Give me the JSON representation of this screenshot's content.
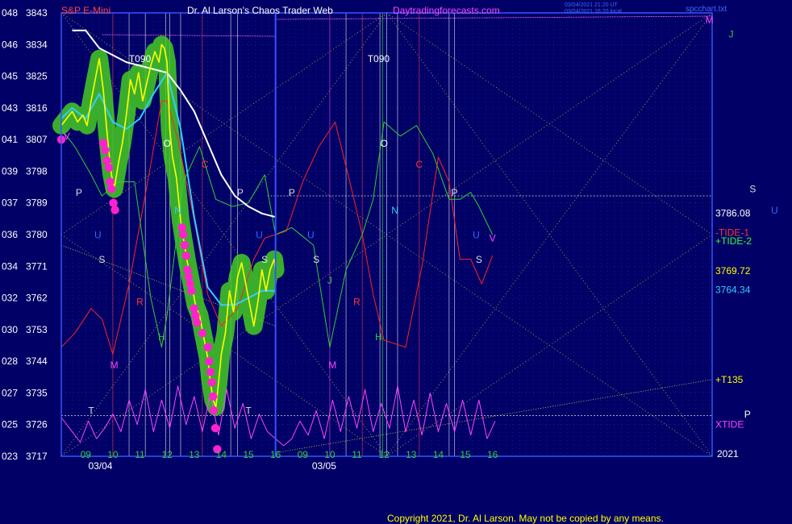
{
  "header": {
    "instrument": "S&P E-Mini",
    "title": "Dr. Al Larson's Chaos Trader Web",
    "site": "Daytradingforecasts.com",
    "stamp_line1": "03/04/2021 21:20 UT",
    "stamp_line2": "03/04/2021 16:20 local",
    "file_name": "spcchart.txt"
  },
  "footer": {
    "copyright": "Copyright 2021, Dr. Al Larson. May not be copied by any means."
  },
  "year_label": "2021",
  "colors": {
    "background": "#000066",
    "price": "#ffff00",
    "price_glow": "#44cc22",
    "ema_fast": "#33ccff",
    "ema_slow": "#ffffff",
    "tide1": "#ff2222",
    "tide2": "#33cc33",
    "xtide": "#ff44ff",
    "dots": "#ff22cc",
    "axis": "#3355ff",
    "text_light": "#ffffff"
  },
  "chart_data": {
    "type": "line",
    "title": "Dr. Al Larson's Chaos Trader Web",
    "xlabel": "",
    "ylabel": "",
    "ylim": [
      3717,
      3843
    ],
    "y_ticks": [
      {
        "left": "048",
        "value": 3843
      },
      {
        "left": "046",
        "value": 3834
      },
      {
        "left": "045",
        "value": 3825
      },
      {
        "left": "043",
        "value": 3816
      },
      {
        "left": "041",
        "value": 3807
      },
      {
        "left": "039",
        "value": 3798
      },
      {
        "left": "037",
        "value": 3789
      },
      {
        "left": "036",
        "value": 3780
      },
      {
        "left": "034",
        "value": 3771
      },
      {
        "left": "032",
        "value": 3762
      },
      {
        "left": "030",
        "value": 3753
      },
      {
        "left": "028",
        "value": 3744
      },
      {
        "left": "027",
        "value": 3735
      },
      {
        "left": "025",
        "value": 3726
      },
      {
        "left": "023",
        "value": 3717
      }
    ],
    "x_range": [
      8.1,
      32.1
    ],
    "hour_ticks": [
      {
        "label": "09",
        "x": 9
      },
      {
        "label": "10",
        "x": 10
      },
      {
        "label": "11",
        "x": 11
      },
      {
        "label": "12",
        "x": 12
      },
      {
        "label": "13",
        "x": 13
      },
      {
        "label": "14",
        "x": 14
      },
      {
        "label": "15",
        "x": 15
      },
      {
        "label": "16",
        "x": 16
      },
      {
        "label": "09",
        "x": 17
      },
      {
        "label": "10",
        "x": 18
      },
      {
        "label": "11",
        "x": 19
      },
      {
        "label": "12",
        "x": 20
      },
      {
        "label": "13",
        "x": 21
      },
      {
        "label": "14",
        "x": 22
      },
      {
        "label": "15",
        "x": 23
      },
      {
        "label": "16",
        "x": 24
      }
    ],
    "dates": [
      {
        "label": "03/04",
        "x": 8.5
      },
      {
        "label": "03/05",
        "x": 16.75
      }
    ],
    "right_labels": [
      {
        "text": "3786.08",
        "value": 3786.08,
        "color": "#ffffff"
      },
      {
        "text": "-TIDE-1",
        "value": 3780.6,
        "color": "#ff3333"
      },
      {
        "text": "+TIDE-2",
        "value": 3778.2,
        "color": "#33ff33"
      },
      {
        "text": "3769.72",
        "value": 3769.72,
        "color": "#ffff00"
      },
      {
        "text": "3764.34",
        "value": 3764.34,
        "color": "#33ccff"
      },
      {
        "text": "+T135",
        "value": 3738.8,
        "color": "#ffff00"
      },
      {
        "text": "XTIDE",
        "value": 3726,
        "color": "#ff44ff"
      }
    ],
    "annotations": [
      {
        "text": "T090",
        "x": 11.0,
        "y": 3829,
        "color": "#ffffff"
      },
      {
        "text": "T090",
        "x": 19.8,
        "y": 3829,
        "color": "#ffffff"
      },
      {
        "text": "M",
        "x": 32.0,
        "y": 3840,
        "color": "#ff44ff"
      },
      {
        "text": "J",
        "x": 32.8,
        "y": 3836,
        "color": "#33cc33"
      },
      {
        "text": "S",
        "x": 33.6,
        "y": 3792,
        "color": "#dddddd"
      },
      {
        "text": "U",
        "x": 34.4,
        "y": 3786,
        "color": "#3366ff"
      },
      {
        "text": "P",
        "x": 33.4,
        "y": 3728,
        "color": "#ffffff"
      },
      {
        "text": "V",
        "x": 8.3,
        "y": 3807,
        "color": "#ff44ff"
      },
      {
        "text": "P",
        "x": 8.75,
        "y": 3791,
        "color": "#dddddd"
      },
      {
        "text": "U",
        "x": 9.45,
        "y": 3779,
        "color": "#3366ff"
      },
      {
        "text": "S",
        "x": 9.6,
        "y": 3772,
        "color": "#dddddd"
      },
      {
        "text": "R",
        "x": 11.0,
        "y": 3760,
        "color": "#ff3333"
      },
      {
        "text": "H",
        "x": 11.8,
        "y": 3750,
        "color": "#33cc33"
      },
      {
        "text": "M",
        "x": 10.05,
        "y": 3742,
        "color": "#ff44ff"
      },
      {
        "text": "T",
        "x": 9.2,
        "y": 3729,
        "color": "#dddddd"
      },
      {
        "text": "O",
        "x": 12.0,
        "y": 3805,
        "color": "#ffffff"
      },
      {
        "text": "N",
        "x": 12.4,
        "y": 3786,
        "color": "#33ccff"
      },
      {
        "text": "C",
        "x": 13.4,
        "y": 3799,
        "color": "#ff3333"
      },
      {
        "text": "P",
        "x": 14.7,
        "y": 3791,
        "color": "#dddddd"
      },
      {
        "text": "U",
        "x": 15.4,
        "y": 3779,
        "color": "#3366ff"
      },
      {
        "text": "S",
        "x": 15.6,
        "y": 3772,
        "color": "#dddddd"
      },
      {
        "text": "T",
        "x": 15.0,
        "y": 3729,
        "color": "#dddddd"
      },
      {
        "text": "P",
        "x": 16.6,
        "y": 3791,
        "color": "#dddddd"
      },
      {
        "text": "U",
        "x": 17.3,
        "y": 3779,
        "color": "#3366ff"
      },
      {
        "text": "S",
        "x": 17.5,
        "y": 3772,
        "color": "#dddddd"
      },
      {
        "text": "J",
        "x": 18.0,
        "y": 3766,
        "color": "#33cc33"
      },
      {
        "text": "R",
        "x": 19.0,
        "y": 3760,
        "color": "#ff3333"
      },
      {
        "text": "H",
        "x": 19.8,
        "y": 3750,
        "color": "#33cc33"
      },
      {
        "text": "M",
        "x": 18.1,
        "y": 3742,
        "color": "#ff44ff"
      },
      {
        "text": "O",
        "x": 20.0,
        "y": 3805,
        "color": "#ffffff"
      },
      {
        "text": "N",
        "x": 20.4,
        "y": 3786,
        "color": "#33ccff"
      },
      {
        "text": "C",
        "x": 21.3,
        "y": 3799,
        "color": "#ff3333"
      },
      {
        "text": "P",
        "x": 22.6,
        "y": 3791,
        "color": "#dddddd"
      },
      {
        "text": "U",
        "x": 23.4,
        "y": 3779,
        "color": "#3366ff"
      },
      {
        "text": "S",
        "x": 23.5,
        "y": 3772,
        "color": "#dddddd"
      },
      {
        "text": "V",
        "x": 24.0,
        "y": 3778,
        "color": "#ff44ff"
      }
    ],
    "vertical_lines": [
      {
        "x": 10.0,
        "color": "#ff4444"
      },
      {
        "x": 10.6,
        "color": "#ffffff"
      },
      {
        "x": 11.2,
        "color": "#ffffff"
      },
      {
        "x": 11.95,
        "color": "#ffffff"
      },
      {
        "x": 12.1,
        "color": "#ffffff"
      },
      {
        "x": 12.5,
        "color": "#ffffff"
      },
      {
        "x": 13.3,
        "color": "#ff4444"
      },
      {
        "x": 14.35,
        "color": "#ffffff"
      },
      {
        "x": 14.6,
        "color": "#ffffff"
      },
      {
        "x": 18.0,
        "color": "#ff44ff"
      },
      {
        "x": 18.6,
        "color": "#ffffff"
      },
      {
        "x": 19.2,
        "color": "#ff4444"
      },
      {
        "x": 19.85,
        "color": "#ffffff"
      },
      {
        "x": 19.95,
        "color": "#33ff33"
      },
      {
        "x": 20.1,
        "color": "#ffffff"
      },
      {
        "x": 20.5,
        "color": "#ffffff"
      },
      {
        "x": 21.3,
        "color": "#ff4444"
      },
      {
        "x": 22.4,
        "color": "#ffffff"
      },
      {
        "x": 22.6,
        "color": "#ffffff"
      }
    ],
    "horizontal_lines": [
      {
        "y": 3791.0,
        "x_from": 15.7,
        "x_to": 32.1,
        "color": "#dddddd"
      },
      {
        "y": 3728.6,
        "x_from": 8.1,
        "x_to": 32.1,
        "color": "#dddddd"
      }
    ],
    "series": [
      {
        "name": "Price",
        "color": "#ffff00",
        "x": [
          8.1,
          8.3,
          8.5,
          8.7,
          8.9,
          9.05,
          9.2,
          9.35,
          9.5,
          9.65,
          9.75,
          9.85,
          9.95,
          10.05,
          10.2,
          10.35,
          10.5,
          10.65,
          10.8,
          10.95,
          11.1,
          11.25,
          11.4,
          11.55,
          11.7,
          11.8,
          11.9,
          12.0,
          12.1,
          12.2,
          12.35,
          12.5,
          12.6,
          12.75,
          12.9,
          13.05,
          13.2,
          13.35,
          13.5,
          13.6,
          13.7,
          13.8,
          13.9,
          14.0,
          14.15,
          14.3,
          14.45,
          14.6,
          14.75,
          14.9,
          15.05,
          15.2,
          15.35,
          15.5,
          15.65,
          15.8,
          15.95,
          16.0
        ],
        "y": [
          3811,
          3813,
          3815,
          3812,
          3814,
          3811,
          3818,
          3824,
          3830,
          3821,
          3812,
          3804,
          3797,
          3793,
          3800,
          3806,
          3814,
          3824,
          3820,
          3826,
          3818,
          3823,
          3828,
          3832,
          3829,
          3834,
          3833,
          3829,
          3810,
          3802,
          3796,
          3784,
          3779,
          3772,
          3766,
          3760,
          3757,
          3751,
          3745,
          3738,
          3733,
          3731,
          3738,
          3746,
          3752,
          3764,
          3758,
          3768,
          3772,
          3766,
          3760,
          3754,
          3761,
          3770,
          3764,
          3770,
          3773,
          3770
        ]
      },
      {
        "name": "EMA fast",
        "color": "#33ccff",
        "x": [
          8.1,
          8.5,
          9.0,
          9.5,
          10.0,
          10.5,
          11.0,
          11.5,
          12.0,
          12.5,
          13.0,
          13.5,
          14.0,
          14.5,
          15.0,
          15.5,
          16.0
        ],
        "y": [
          3813,
          3816,
          3813,
          3820,
          3812,
          3810,
          3813,
          3820,
          3826,
          3810,
          3785,
          3765,
          3760,
          3760,
          3762,
          3764,
          3764
        ]
      },
      {
        "name": "EMA slow",
        "color": "#ffffff",
        "x": [
          8.5,
          9.0,
          9.5,
          10.0,
          10.5,
          11.0,
          11.5,
          12.0,
          12.5,
          13.0,
          13.5,
          14.0,
          14.5,
          15.0,
          15.5,
          16.0
        ],
        "y": [
          3838,
          3838,
          3833,
          3831,
          3829,
          3828,
          3827,
          3826,
          3821,
          3815,
          3806,
          3797,
          3791,
          3788,
          3786,
          3785
        ]
      },
      {
        "name": "TIDE-1",
        "color": "#ff2222",
        "x": [
          8.1,
          8.6,
          9.2,
          9.6,
          10.0,
          10.6,
          11.4,
          11.8,
          12.0,
          12.4,
          13.0,
          13.5,
          14.0,
          14.6,
          15.2,
          15.6,
          16.0,
          16.4,
          17.0,
          17.6,
          18.2,
          18.8,
          19.2,
          19.6,
          20.0,
          20.8,
          21.4,
          22.0,
          22.4,
          22.8,
          23.2,
          23.6,
          24.0
        ],
        "y": [
          3748,
          3752,
          3759,
          3756,
          3746,
          3766,
          3800,
          3818,
          3818,
          3807,
          3784,
          3763,
          3754,
          3759,
          3773,
          3779,
          3780,
          3781,
          3795,
          3805,
          3812,
          3793,
          3780,
          3763,
          3750,
          3748,
          3771,
          3802,
          3795,
          3773,
          3773,
          3766,
          3774
        ]
      },
      {
        "name": "TIDE-2",
        "color": "#33cc33",
        "x": [
          8.1,
          8.6,
          9.2,
          9.6,
          10.2,
          10.8,
          11.4,
          11.8,
          12.0,
          12.6,
          13.2,
          13.8,
          14.4,
          15.0,
          15.6,
          16.0,
          16.6,
          17.4,
          18.0,
          18.6,
          19.2,
          19.6,
          20.0,
          20.6,
          21.2,
          21.8,
          22.4,
          22.8,
          23.2,
          23.5,
          24.0
        ],
        "y": [
          3810,
          3805,
          3797,
          3791,
          3795,
          3795,
          3762,
          3748,
          3757,
          3795,
          3805,
          3790,
          3788,
          3789,
          3797,
          3780,
          3782,
          3777,
          3748,
          3770,
          3780,
          3790,
          3812,
          3808,
          3811,
          3803,
          3790,
          3790,
          3792,
          3788,
          3780
        ]
      },
      {
        "name": "XTIDE",
        "color": "#ff44ff",
        "x": [
          8.1,
          8.5,
          8.8,
          9.1,
          9.4,
          9.7,
          10.0,
          10.3,
          10.6,
          10.9,
          11.2,
          11.5,
          11.8,
          12.1,
          12.4,
          12.7,
          13.0,
          13.3,
          13.6,
          13.9,
          14.2,
          14.5,
          14.8,
          15.1,
          15.4,
          15.7,
          16.0,
          16.3,
          16.6,
          16.9,
          17.2,
          17.5,
          17.8,
          18.1,
          18.4,
          18.7,
          19.0,
          19.3,
          19.6,
          19.9,
          20.2,
          20.5,
          20.8,
          21.1,
          21.4,
          21.7,
          22.0,
          22.3,
          22.6,
          22.9,
          23.2,
          23.5,
          23.8,
          24.1
        ],
        "y": [
          3728,
          3724,
          3721,
          3727,
          3722,
          3725,
          3729,
          3724,
          3733,
          3726,
          3736,
          3724,
          3733,
          3725,
          3737,
          3726,
          3734,
          3724,
          3735,
          3723,
          3736,
          3725,
          3732,
          3722,
          3729,
          3724,
          3722,
          3720,
          3722,
          3727,
          3723,
          3730,
          3722,
          3733,
          3724,
          3734,
          3725,
          3736,
          3724,
          3732,
          3725,
          3737,
          3724,
          3733,
          3723,
          3735,
          3724,
          3732,
          3724,
          3733,
          3723,
          3733,
          3722,
          3727
        ]
      }
    ],
    "dots": [
      {
        "x": 8.1,
        "y": 3807
      },
      {
        "x": 9.65,
        "y": 3806
      },
      {
        "x": 9.72,
        "y": 3804
      },
      {
        "x": 9.78,
        "y": 3801
      },
      {
        "x": 9.85,
        "y": 3799
      },
      {
        "x": 9.9,
        "y": 3795
      },
      {
        "x": 9.95,
        "y": 3793
      },
      {
        "x": 10.02,
        "y": 3789
      },
      {
        "x": 10.08,
        "y": 3787
      },
      {
        "x": 12.55,
        "y": 3782
      },
      {
        "x": 12.6,
        "y": 3780
      },
      {
        "x": 12.65,
        "y": 3777
      },
      {
        "x": 12.7,
        "y": 3774
      },
      {
        "x": 12.75,
        "y": 3770
      },
      {
        "x": 12.8,
        "y": 3768
      },
      {
        "x": 12.85,
        "y": 3766
      },
      {
        "x": 12.9,
        "y": 3764
      },
      {
        "x": 13.0,
        "y": 3759
      },
      {
        "x": 13.05,
        "y": 3757
      },
      {
        "x": 13.1,
        "y": 3755
      },
      {
        "x": 13.3,
        "y": 3752
      },
      {
        "x": 13.5,
        "y": 3748
      },
      {
        "x": 13.55,
        "y": 3744
      },
      {
        "x": 13.6,
        "y": 3741
      },
      {
        "x": 13.65,
        "y": 3738
      },
      {
        "x": 13.7,
        "y": 3734
      },
      {
        "x": 13.72,
        "y": 3730
      },
      {
        "x": 13.78,
        "y": 3725
      },
      {
        "x": 13.85,
        "y": 3719
      }
    ],
    "grid": true,
    "legend": "none"
  }
}
